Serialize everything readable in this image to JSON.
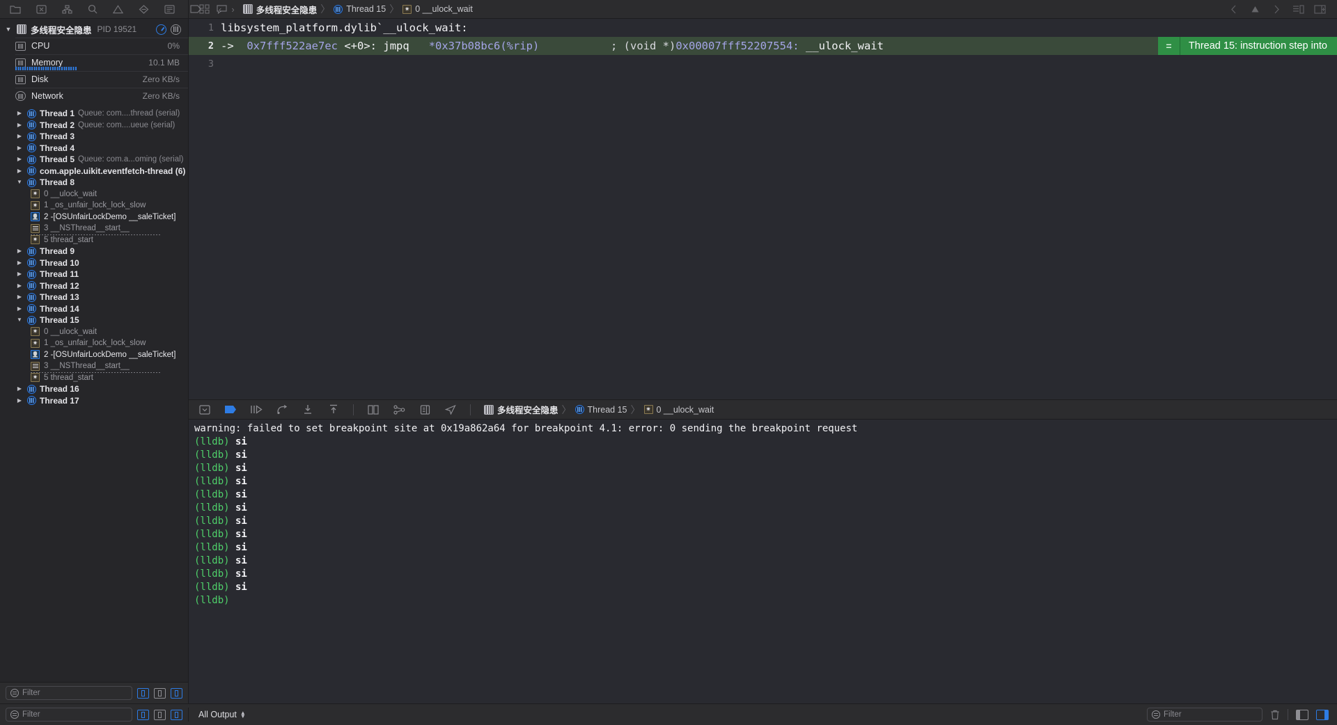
{
  "toolbar": {
    "left_icons": [
      "folder-icon",
      "issue-icon",
      "hierarchy-icon",
      "search-icon",
      "warning-icon",
      "breakpoint-icon",
      "report-icon",
      "tag-icon",
      "comment-icon"
    ],
    "nav_back_label": "‹",
    "nav_forward_label": "›",
    "breadcrumb": {
      "project": "多线程安全隐患",
      "thread": "Thread 15",
      "frame": "0 __ulock_wait"
    },
    "right_icons": [
      "chevron-left-icon",
      "triangle-icon",
      "chevron-right-icon",
      "editor-options-icon",
      "right-panel-icon"
    ]
  },
  "navigator": {
    "process": {
      "name": "多线程安全隐患",
      "pid": "PID 19521"
    },
    "resources": [
      {
        "name": "CPU",
        "value": "0%",
        "icon": "cpu-icon",
        "gauge": false
      },
      {
        "name": "Memory",
        "value": "10.1 MB",
        "icon": "memory-icon",
        "gauge": true
      },
      {
        "name": "Disk",
        "value": "Zero KB/s",
        "icon": "disk-icon",
        "gauge": false
      },
      {
        "name": "Network",
        "value": "Zero KB/s",
        "icon": "network-icon",
        "gauge": false
      }
    ],
    "threads": [
      {
        "label": "Thread 1",
        "queue": "Queue: com....thread (serial)",
        "expanded": false
      },
      {
        "label": "Thread 2",
        "queue": "Queue: com....ueue (serial)",
        "expanded": false
      },
      {
        "label": "Thread 3",
        "queue": "",
        "expanded": false
      },
      {
        "label": "Thread 4",
        "queue": "",
        "expanded": false
      },
      {
        "label": "Thread 5",
        "queue": "Queue: com.a...oming (serial)",
        "expanded": false
      },
      {
        "label": "com.apple.uikit.eventfetch-thread (6)",
        "queue": "",
        "expanded": false
      },
      {
        "label": "Thread 8",
        "queue": "",
        "expanded": true,
        "frames": [
          {
            "label": "0 __ulock_wait",
            "kind": "system",
            "dotted": false
          },
          {
            "label": "1 _os_unfair_lock_lock_slow",
            "kind": "system",
            "dotted": false
          },
          {
            "label": "2 -[OSUnfairLockDemo __saleTicket]",
            "kind": "user",
            "dotted": false
          },
          {
            "label": "3 __NSThread__start__",
            "kind": "lib",
            "dotted": true
          },
          {
            "label": "5 thread_start",
            "kind": "system",
            "dotted": false
          }
        ]
      },
      {
        "label": "Thread 9",
        "queue": "",
        "expanded": false
      },
      {
        "label": "Thread 10",
        "queue": "",
        "expanded": false
      },
      {
        "label": "Thread 11",
        "queue": "",
        "expanded": false
      },
      {
        "label": "Thread 12",
        "queue": "",
        "expanded": false
      },
      {
        "label": "Thread 13",
        "queue": "",
        "expanded": false
      },
      {
        "label": "Thread 14",
        "queue": "",
        "expanded": false
      },
      {
        "label": "Thread 15",
        "queue": "",
        "expanded": true,
        "current": true,
        "frames": [
          {
            "label": "0 __ulock_wait",
            "kind": "system",
            "dotted": false,
            "current": true
          },
          {
            "label": "1 _os_unfair_lock_lock_slow",
            "kind": "system",
            "dotted": false
          },
          {
            "label": "2 -[OSUnfairLockDemo __saleTicket]",
            "kind": "user",
            "dotted": false
          },
          {
            "label": "3 __NSThread__start__",
            "kind": "lib",
            "dotted": true
          },
          {
            "label": "5 thread_start",
            "kind": "system",
            "dotted": false
          }
        ]
      },
      {
        "label": "Thread 16",
        "queue": "",
        "expanded": false
      },
      {
        "label": "Thread 17",
        "queue": "",
        "expanded": false
      }
    ],
    "filter": {
      "placeholder": "Filter",
      "buttons": [
        "show-only-crashed-icon",
        "show-queues-icon",
        "show-frames-icon"
      ]
    }
  },
  "editor": {
    "lines": [
      {
        "num": "1",
        "arrow": "",
        "addr": "",
        "text": "libsystem_platform.dylib`__ulock_wait:",
        "highlight": false
      },
      {
        "num": "2",
        "arrow": "->",
        "addr": "0x7fff522ae7ec",
        "offset": "<+0>:",
        "mnemonic": "jmpq",
        "operand": "*0x37b08bc6(%rip)",
        "comment_sep": ";",
        "comment_cast": "(void *)",
        "comment_addr": "0x00007fff52207554:",
        "comment_sym": "__ulock_wait",
        "highlight": true
      },
      {
        "num": "3",
        "arrow": "",
        "addr": "",
        "text": "",
        "highlight": false
      }
    ],
    "badge": {
      "equals": "=",
      "text": "Thread 15: instruction step into",
      "color": "#2f8f45"
    }
  },
  "debug_bar": {
    "icons": [
      "hide-debug-area-icon",
      "breakpoints-toggle-icon",
      "continue-icon",
      "step-over-icon",
      "step-into-icon",
      "step-out-icon",
      "view-debugging-icon",
      "memory-graph-icon",
      "environment-overrides-icon",
      "simulate-location-icon"
    ],
    "breadcrumb": {
      "project": "多线程安全隐患",
      "thread": "Thread 15",
      "frame": "0 __ulock_wait"
    }
  },
  "console": {
    "lines": [
      {
        "type": "warning",
        "text": "warning: failed to set breakpoint site at 0x19a862a64 for breakpoint 4.1: error: 0 sending the breakpoint request"
      },
      {
        "type": "cmd",
        "prompt": "(lldb)",
        "text": "si"
      },
      {
        "type": "cmd",
        "prompt": "(lldb)",
        "text": "si"
      },
      {
        "type": "cmd",
        "prompt": "(lldb)",
        "text": "si"
      },
      {
        "type": "cmd",
        "prompt": "(lldb)",
        "text": "si"
      },
      {
        "type": "cmd",
        "prompt": "(lldb)",
        "text": "si"
      },
      {
        "type": "cmd",
        "prompt": "(lldb)",
        "text": "si"
      },
      {
        "type": "cmd",
        "prompt": "(lldb)",
        "text": "si"
      },
      {
        "type": "cmd",
        "prompt": "(lldb)",
        "text": "si"
      },
      {
        "type": "cmd",
        "prompt": "(lldb)",
        "text": "si"
      },
      {
        "type": "cmd",
        "prompt": "(lldb)",
        "text": "si"
      },
      {
        "type": "cmd",
        "prompt": "(lldb)",
        "text": "si"
      },
      {
        "type": "cmd",
        "prompt": "(lldb)",
        "text": "si"
      },
      {
        "type": "cmd",
        "prompt": "(lldb)",
        "text": ""
      }
    ]
  },
  "status_bar": {
    "filter_placeholder": "Filter",
    "output_scope": "All Output",
    "console_filter_placeholder": "Filter",
    "trash_icon": "trash-icon",
    "pane_icons": [
      "show-console-only-icon",
      "show-variables-and-console-icon"
    ]
  },
  "colors": {
    "accent_blue": "#2e7ce4",
    "status_green": "#2f8f45",
    "highlight_line": "#3a4a3a",
    "console_prompt_green": "#4fd06a",
    "editor_bg": "#292a30",
    "navigator_bg": "#262629",
    "chrome_bg": "#2c2c2e"
  }
}
